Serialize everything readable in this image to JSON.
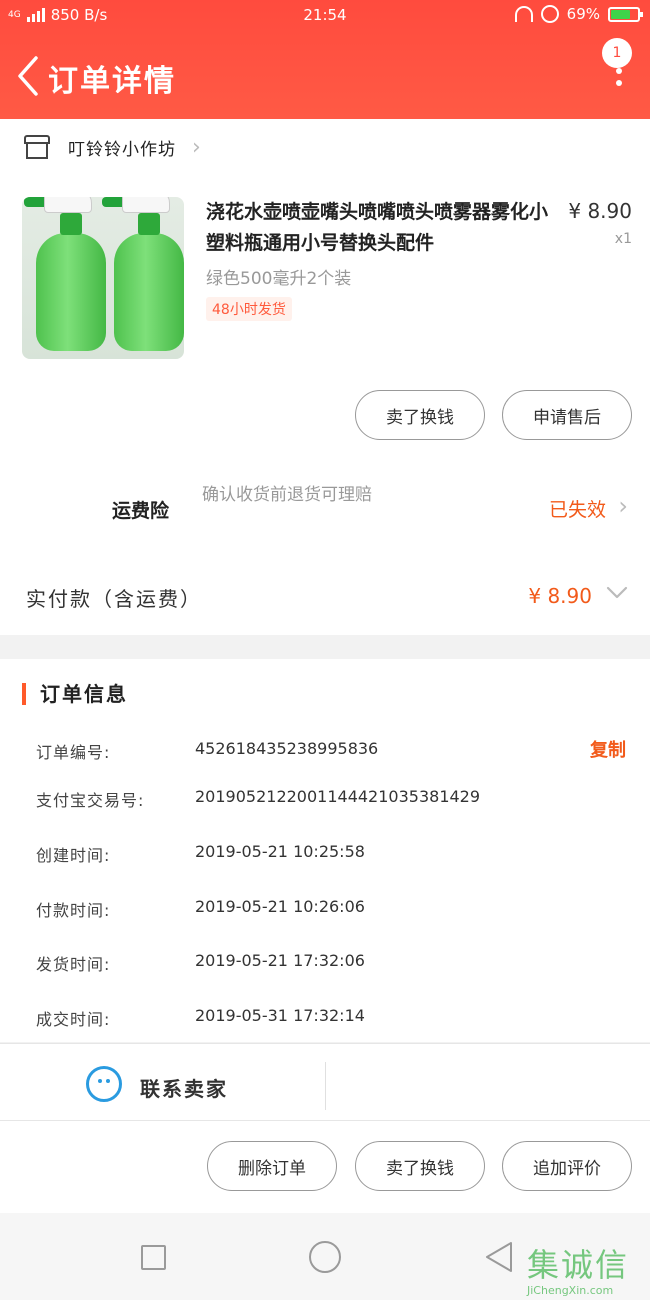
{
  "status_bar": {
    "network": "4G",
    "speed": "850 B/s",
    "time": "21:54",
    "battery": "69%",
    "battery_level": 0.69
  },
  "header": {
    "title": "订单详情",
    "badge_count": "1"
  },
  "shop": {
    "name": "叮铃铃小作坊"
  },
  "product": {
    "title": "浇花水壶喷壶嘴头喷嘴喷头喷雾器雾化小塑料瓶通用小号替换头配件",
    "price": "¥ 8.90",
    "quantity": "x1",
    "spec": "绿色500毫升2个装",
    "tag": "48小时发货"
  },
  "product_actions": {
    "buy_again": "卖了换钱",
    "after_sale": "申请售后"
  },
  "insurance": {
    "label": "运费险",
    "desc": "确认收货前退货可理赔",
    "status": "已失效"
  },
  "payment": {
    "label": "实付款（含运费）",
    "amount": "¥ 8.90"
  },
  "order_info": {
    "title": "订单信息",
    "copy_label": "复制",
    "rows": [
      {
        "label": "订单编号:",
        "value": "452618435238995836"
      },
      {
        "label": "支付宝交易号:",
        "value": "2019052122001144421035381429"
      },
      {
        "label": "创建时间:",
        "value": "2019-05-21 10:25:58"
      },
      {
        "label": "付款时间:",
        "value": "2019-05-21 10:26:06"
      },
      {
        "label": "发货时间:",
        "value": "2019-05-21 17:32:06"
      },
      {
        "label": "成交时间:",
        "value": "2019-05-31 17:32:14"
      }
    ]
  },
  "contact": {
    "label": "联系卖家"
  },
  "bottom_actions": {
    "delete_order": "删除订单",
    "sell": "卖了换钱",
    "add_review": "追加评价"
  },
  "watermark": {
    "mark": "集诚信",
    "url": "JiChengXin.com"
  },
  "colors": {
    "brand": "#ff4b3e",
    "accent": "#f25a1a",
    "contact_icon": "#2a9be0"
  }
}
